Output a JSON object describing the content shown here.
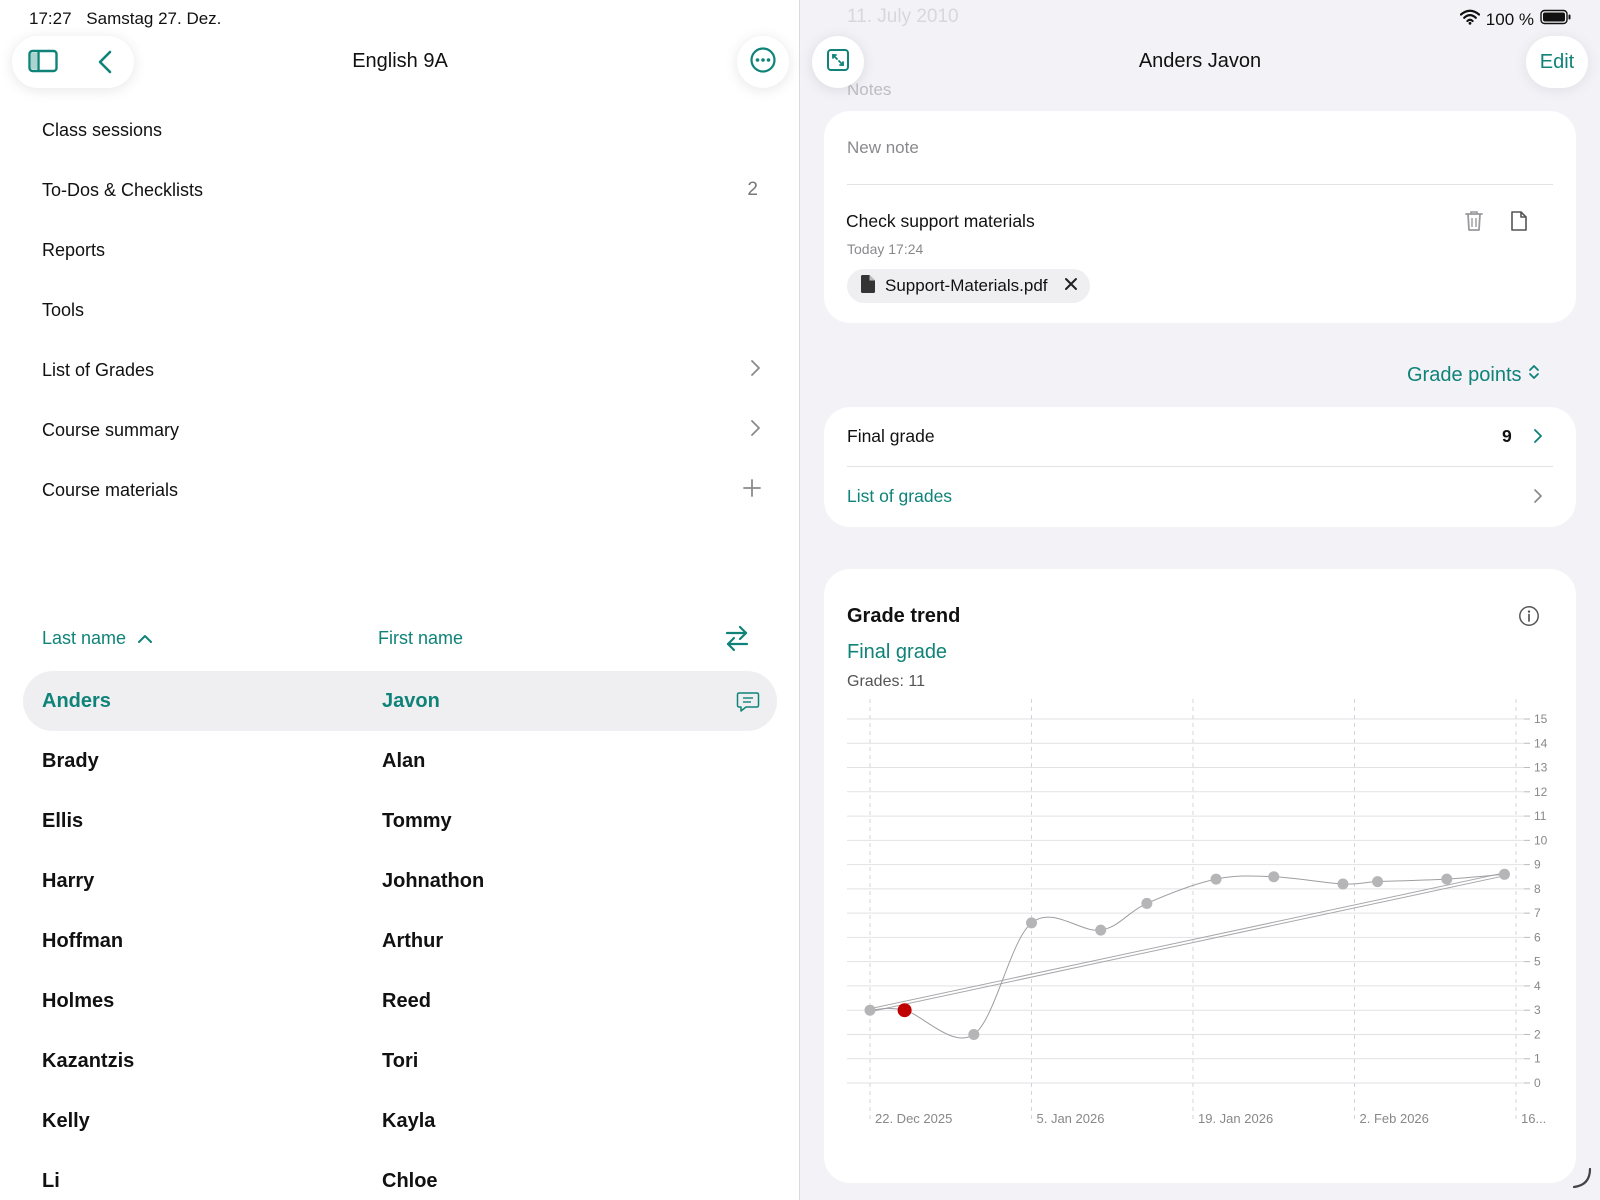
{
  "status": {
    "time": "17:27",
    "date": "Samstag 27. Dez.",
    "battery": "100 %"
  },
  "left": {
    "title": "English 9A",
    "menu": [
      {
        "label": "Class sessions",
        "trail": ""
      },
      {
        "label": "To-Dos & Checklists",
        "trail": "2"
      },
      {
        "label": "Reports",
        "trail": ""
      },
      {
        "label": "Tools",
        "trail": ""
      },
      {
        "label": "List of Grades",
        "trail": "chevron-right-icon"
      },
      {
        "label": "Course summary",
        "trail": "chevron-right-icon"
      },
      {
        "label": "Course materials",
        "trail": "plus-icon"
      }
    ],
    "columns": {
      "last": "Last name",
      "first": "First name"
    },
    "students": [
      {
        "last": "Anders",
        "first": "Javon",
        "selected": true
      },
      {
        "last": "Brady",
        "first": "Alan"
      },
      {
        "last": "Ellis",
        "first": "Tommy"
      },
      {
        "last": "Harry",
        "first": "Johnathon"
      },
      {
        "last": "Hoffman",
        "first": "Arthur"
      },
      {
        "last": "Holmes",
        "first": "Reed"
      },
      {
        "last": "Kazantzis",
        "first": "Tori"
      },
      {
        "last": "Kelly",
        "first": "Kayla"
      },
      {
        "last": "Li",
        "first": "Chloe"
      }
    ]
  },
  "right": {
    "ghost_date": "11. July 2010",
    "ghost_notes": "Notes",
    "title": "Anders Javon",
    "edit": "Edit",
    "notes": {
      "placeholder": "New note",
      "title": "Check support materials",
      "time": "Today 17:24",
      "attachment": "Support-Materials.pdf"
    },
    "grade_points": "Grade points",
    "final_grade": {
      "label": "Final grade",
      "value": "9"
    },
    "list_of_grades": "List of grades",
    "trend": {
      "title": "Grade trend",
      "subtitle": "Final grade",
      "count": "Grades: 11"
    }
  },
  "colors": {
    "accent": "#0f8378",
    "highlight_point": "#c00000",
    "point": "#b5b5b8"
  },
  "chart_data": {
    "type": "line",
    "title": "Grade trend",
    "ylim": [
      0,
      15
    ],
    "y_ticks": [
      "0",
      "1",
      "2",
      "3",
      "4",
      "5",
      "6",
      "7",
      "8",
      "9",
      "10",
      "11",
      "12",
      "13",
      "14",
      "15"
    ],
    "x_ticks": [
      "22. Dec 2025",
      "5. Jan 2026",
      "19. Jan 2026",
      "2. Feb 2026",
      "16..."
    ],
    "grid": true,
    "series": [
      {
        "values": [
          3.0,
          3.0,
          2.0,
          6.6,
          6.3,
          7.4,
          8.4,
          8.5,
          8.2,
          8.3,
          8.4,
          8.6
        ],
        "x_day_offsets": [
          0,
          3,
          9,
          14,
          20,
          24,
          30,
          35,
          41,
          44,
          50,
          55
        ],
        "highlight_index": 1
      }
    ],
    "trend_line": {
      "from": 3.0,
      "to": 8.6
    }
  }
}
